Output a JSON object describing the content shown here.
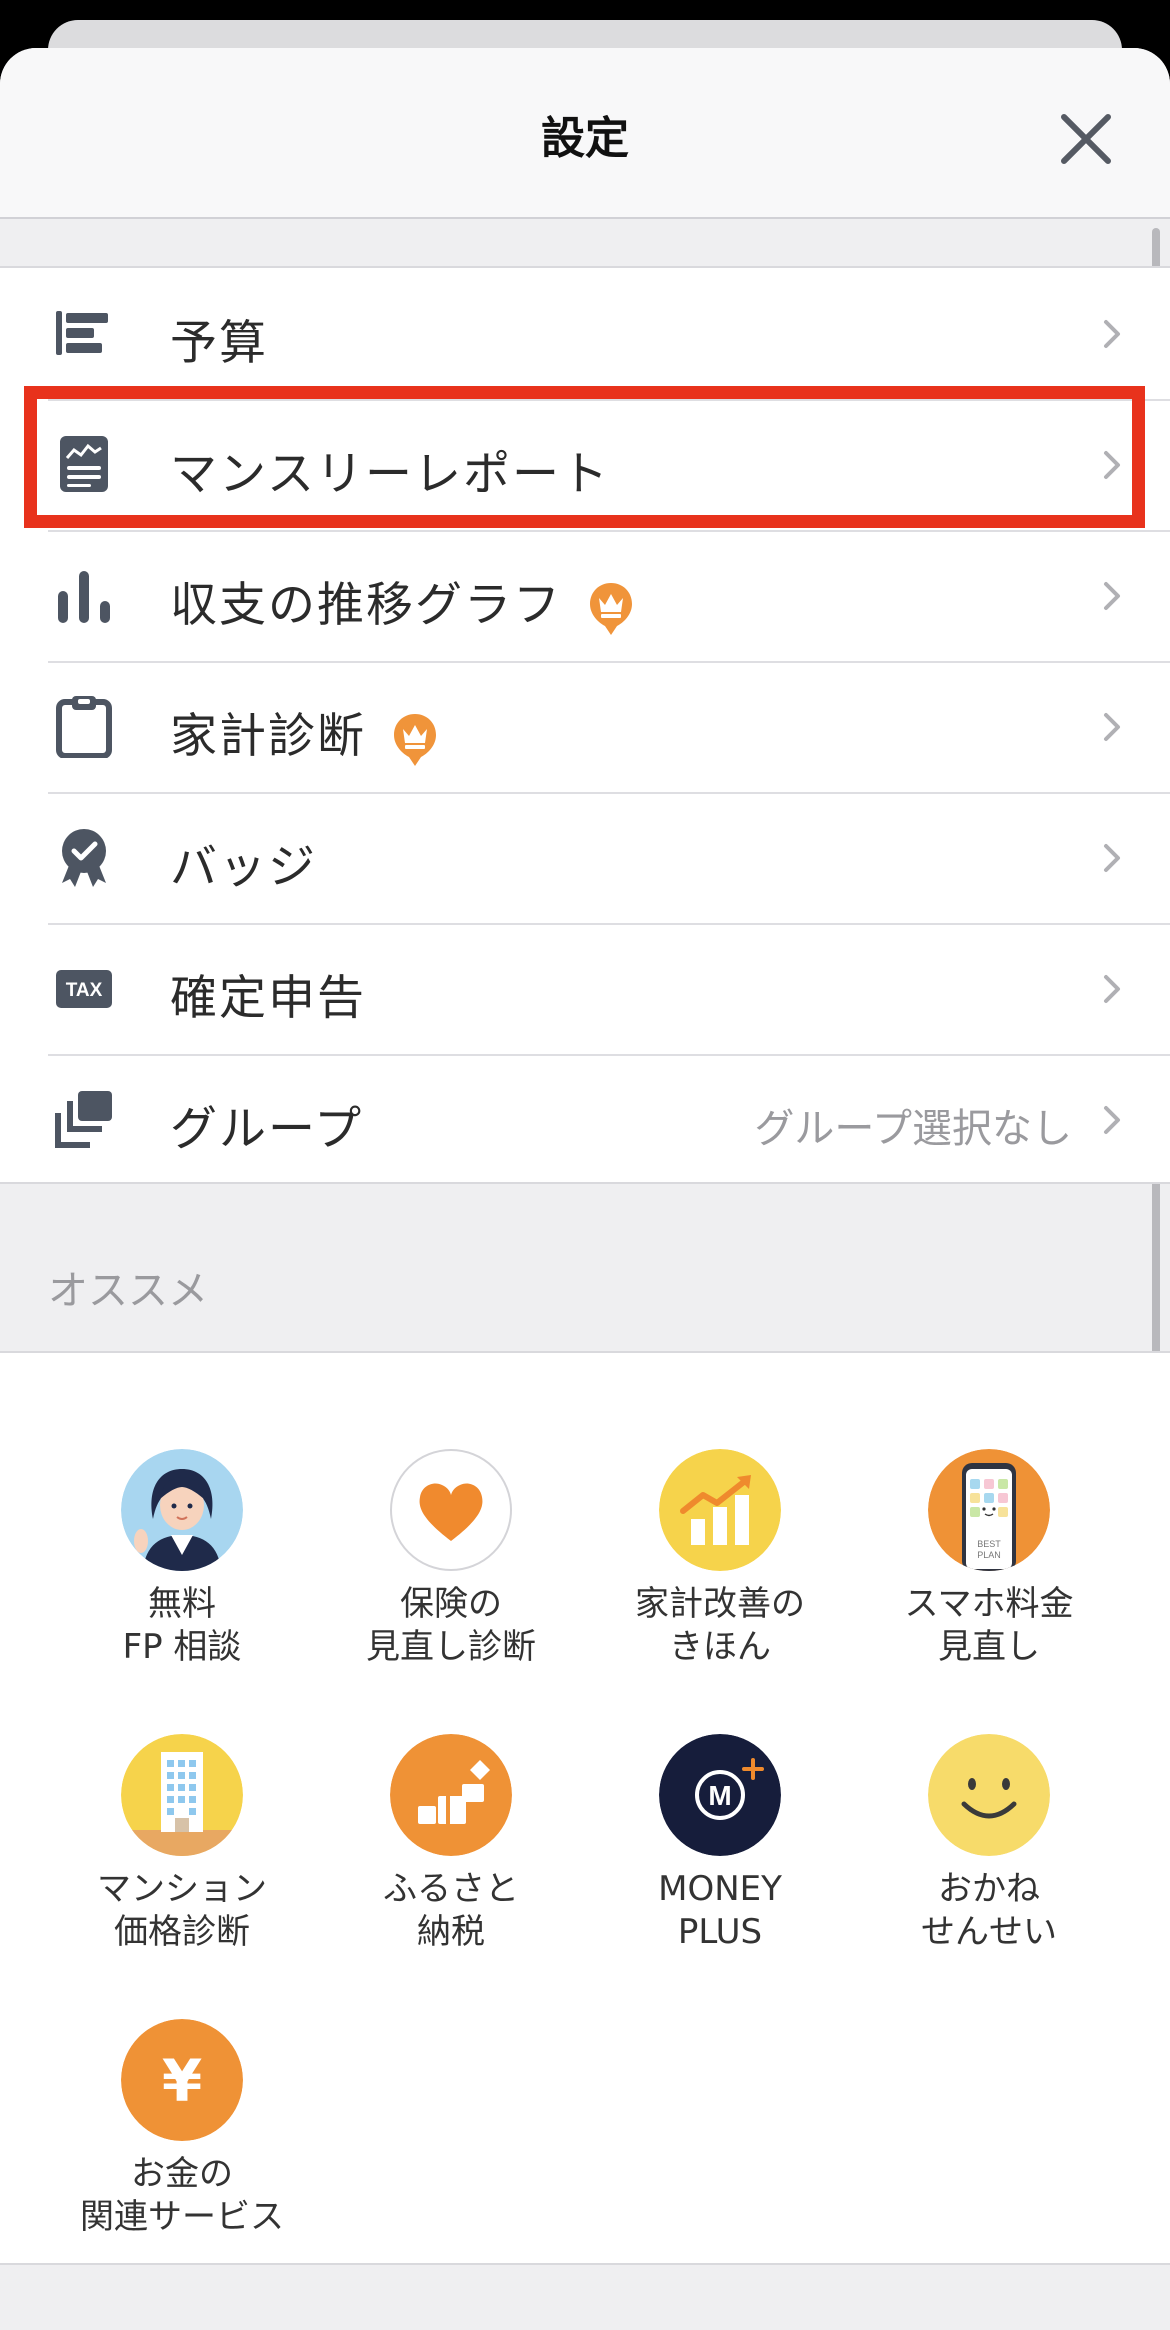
{
  "header": {
    "title": "設定"
  },
  "settings": [
    {
      "label": "予算",
      "icon": "budget-bars-icon"
    },
    {
      "label": "マンスリーレポート",
      "icon": "report-icon"
    },
    {
      "label": "収支の推移グラフ",
      "icon": "bar-graph-icon",
      "premium": true
    },
    {
      "label": "家計診断",
      "icon": "clipboard-icon",
      "premium": true
    },
    {
      "label": "バッジ",
      "icon": "badge-icon"
    },
    {
      "label": "確定申告",
      "icon": "tax-icon"
    },
    {
      "label": "グループ",
      "icon": "group-icon",
      "value": "グループ選択なし"
    }
  ],
  "recommend": {
    "title": "オススメ",
    "items": [
      {
        "label": "無料\nFP 相談",
        "icon": "advisor-woman-icon"
      },
      {
        "label": "保険の\n見直し診断",
        "icon": "heart-icon"
      },
      {
        "label": "家計改善の\nきほん",
        "icon": "growth-chart-icon"
      },
      {
        "label": "スマホ料金\n見直し",
        "icon": "smartphone-best-plan-icon",
        "icon_text": [
          "BEST",
          "PLAN"
        ]
      },
      {
        "label": "マンション\n価格診断",
        "icon": "apartment-building-icon"
      },
      {
        "label": "ふるさと\n納税",
        "icon": "hometown-tax-boxes-icon"
      },
      {
        "label": "MONEY\nPLUS",
        "icon": "money-plus-icon",
        "icon_text": "M"
      },
      {
        "label": "おかね\nせんせい",
        "icon": "smiley-face-icon"
      },
      {
        "label": "お金の\n関連サービス",
        "icon": "yen-icon",
        "icon_text": "¥"
      }
    ]
  },
  "colors": {
    "icon_gray": "#4d5562",
    "chevron_gray": "#b0b0b4",
    "crown_orange": "#f0943a",
    "highlight_red": "#e8321c",
    "navy": "#161d3b",
    "yellow": "#f6d34b"
  }
}
